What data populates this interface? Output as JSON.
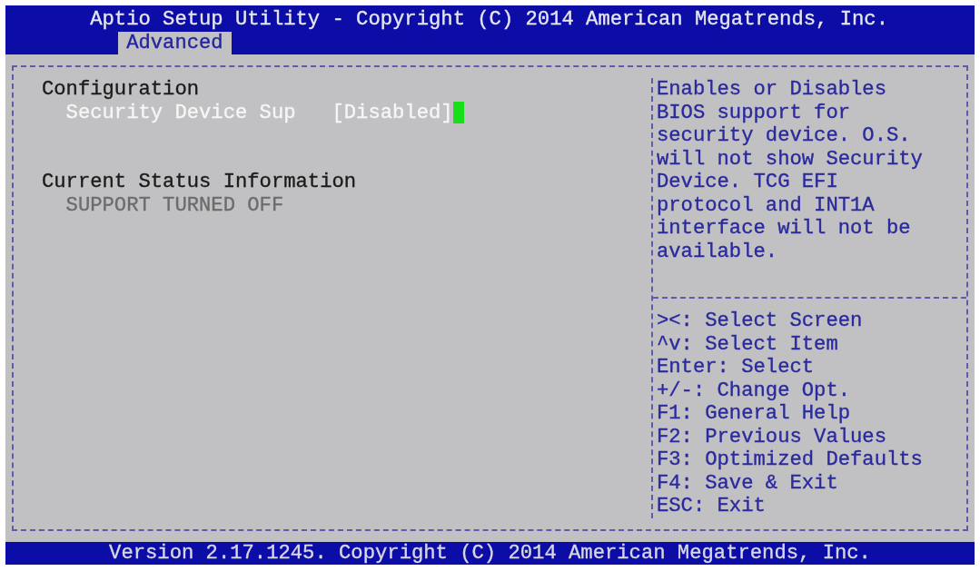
{
  "header": {
    "title": "Aptio Setup Utility - Copyright (C) 2014 American Megatrends, Inc.",
    "tabs": [
      {
        "label": "Advanced",
        "selected": true
      }
    ]
  },
  "sections": [
    {
      "heading": "Configuration",
      "items": [
        {
          "kind": "setting",
          "label": "Security Device Sup",
          "value": "[Disabled]",
          "selected": true
        }
      ]
    },
    {
      "heading": "Current Status Information",
      "items": [
        {
          "kind": "info",
          "label": "SUPPORT TURNED OFF"
        }
      ]
    }
  ],
  "help_text": "Enables or Disables BIOS support for security device. O.S. will not show Security Device. TCG EFI protocol and INT1A interface will not be available.",
  "key_hints": [
    "><: Select Screen",
    "^v: Select Item",
    "Enter: Select",
    "+/-: Change Opt.",
    "F1: General Help",
    "F2: Previous Values",
    "F3: Optimized Defaults",
    "F4: Save & Exit",
    "ESC: Exit"
  ],
  "footer": "Version 2.17.1245. Copyright (C) 2014 American Megatrends, Inc."
}
